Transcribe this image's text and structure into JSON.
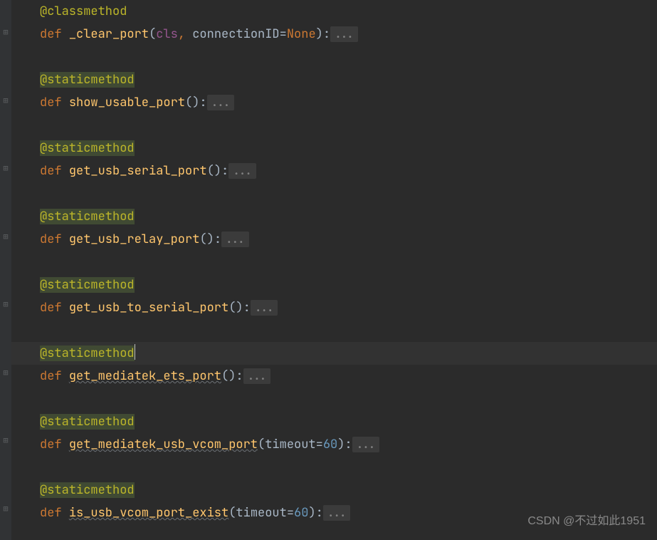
{
  "watermark": "CSDN @不过如此1951",
  "ellipsis": "...",
  "decorators": {
    "classmethod": "@classmethod",
    "staticmethod": "@staticmethod"
  },
  "kw": {
    "def": "def ",
    "none": "None"
  },
  "methods": {
    "m0": {
      "name": "_clear_port",
      "param_self": "cls",
      "param1": "connectionID"
    },
    "m1": {
      "name": "show_usable_port"
    },
    "m2": {
      "name": "get_usb_serial_port"
    },
    "m3": {
      "name": "get_usb_relay_port"
    },
    "m4": {
      "name": "get_usb_to_serial_port"
    },
    "m5": {
      "name": "get_mediatek_ets_port"
    },
    "m6": {
      "name": "get_mediatek_usb_vcom_port",
      "param1": "timeout",
      "default1": "60"
    },
    "m7": {
      "name": "is_usb_vcom_port_exist",
      "param1": "timeout",
      "default1": "60"
    }
  },
  "chart_data": null
}
